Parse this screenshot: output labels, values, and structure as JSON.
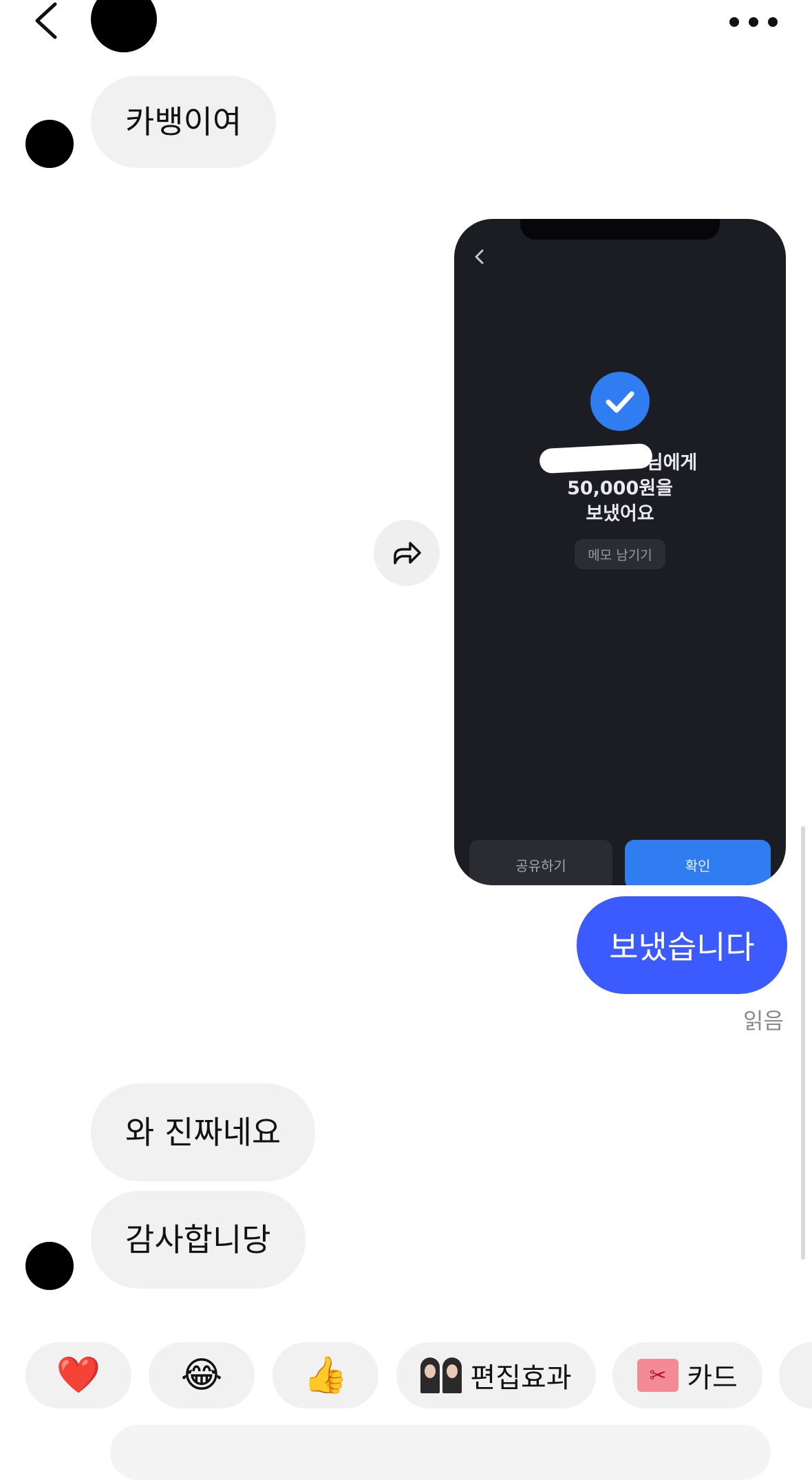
{
  "header": {
    "back_icon": "chevron-left-icon",
    "more_icon": "more-horizontal-icon"
  },
  "messages": {
    "incoming_1": "카뱅이여",
    "outgoing_text": "보냈습니다",
    "read_status": "읽음",
    "incoming_2": "와 진짜네요",
    "incoming_3": "감사합니당"
  },
  "screenshot": {
    "recipient_suffix": "님에게",
    "amount_line": "50,000원을",
    "status_line": "보냈어요",
    "memo_button": "메모 남기기",
    "share_button": "공유하기",
    "confirm_button": "확인",
    "check_color": "#2f7df0"
  },
  "forward_icon": "forward-arrow-icon",
  "reactions": [
    {
      "emoji": "❤️",
      "icon": "heart-icon"
    },
    {
      "emoji": "😂",
      "icon": "laughing-tears-icon"
    },
    {
      "emoji": "👍",
      "icon": "thumbs-up-icon"
    },
    {
      "label": "편집효과",
      "icon": "edit-effect-thumbnail"
    },
    {
      "label": "카드",
      "icon": "gift-card-icon"
    }
  ],
  "colors": {
    "outgoing_bubble": "#3b5bff",
    "incoming_bubble": "#f1f1f1"
  }
}
